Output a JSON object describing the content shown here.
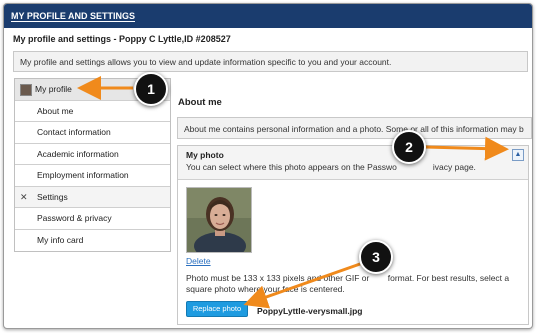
{
  "window": {
    "title": "MY PROFILE AND SETTINGS"
  },
  "header": {
    "breadcrumb": "My profile and settings - Poppy C Lyttle,ID #208527",
    "description": "My profile and settings allows you to view and update information specific to you and your account."
  },
  "sidebar": {
    "items": [
      {
        "label": "My profile",
        "icon": "avatar"
      },
      {
        "label": "About me"
      },
      {
        "label": "Contact information"
      },
      {
        "label": "Academic information"
      },
      {
        "label": "Employment information"
      },
      {
        "label": "Settings",
        "icon": "wrench-screwdriver-icon"
      },
      {
        "label": "Password & privacy"
      },
      {
        "label": "My info card"
      }
    ]
  },
  "main": {
    "heading": "About me",
    "description": "About me contains personal information and a photo. Some or all of this information may b",
    "photo_panel": {
      "title": "My photo",
      "subtitle": "You can select where this photo appears on the Passwo",
      "subtitle_tail": "ivacy page.",
      "delete_label": "Delete",
      "note_line1": "Photo must be 133 x 133 pixels and",
      "note_line1_tail": "other GIF or",
      "note_line1_end": "format. For best results, select a",
      "note_line2": "square photo where your face is centered.",
      "replace_label": "Replace photo",
      "filename": "PoppyLyttle-verysmall.jpg"
    }
  },
  "callouts": [
    "1",
    "2",
    "3"
  ],
  "colors": {
    "titlebar": "#1a3c6e",
    "accent_button": "#1e9be0",
    "arrow": "#f08a1c",
    "link": "#2a6fbf"
  }
}
